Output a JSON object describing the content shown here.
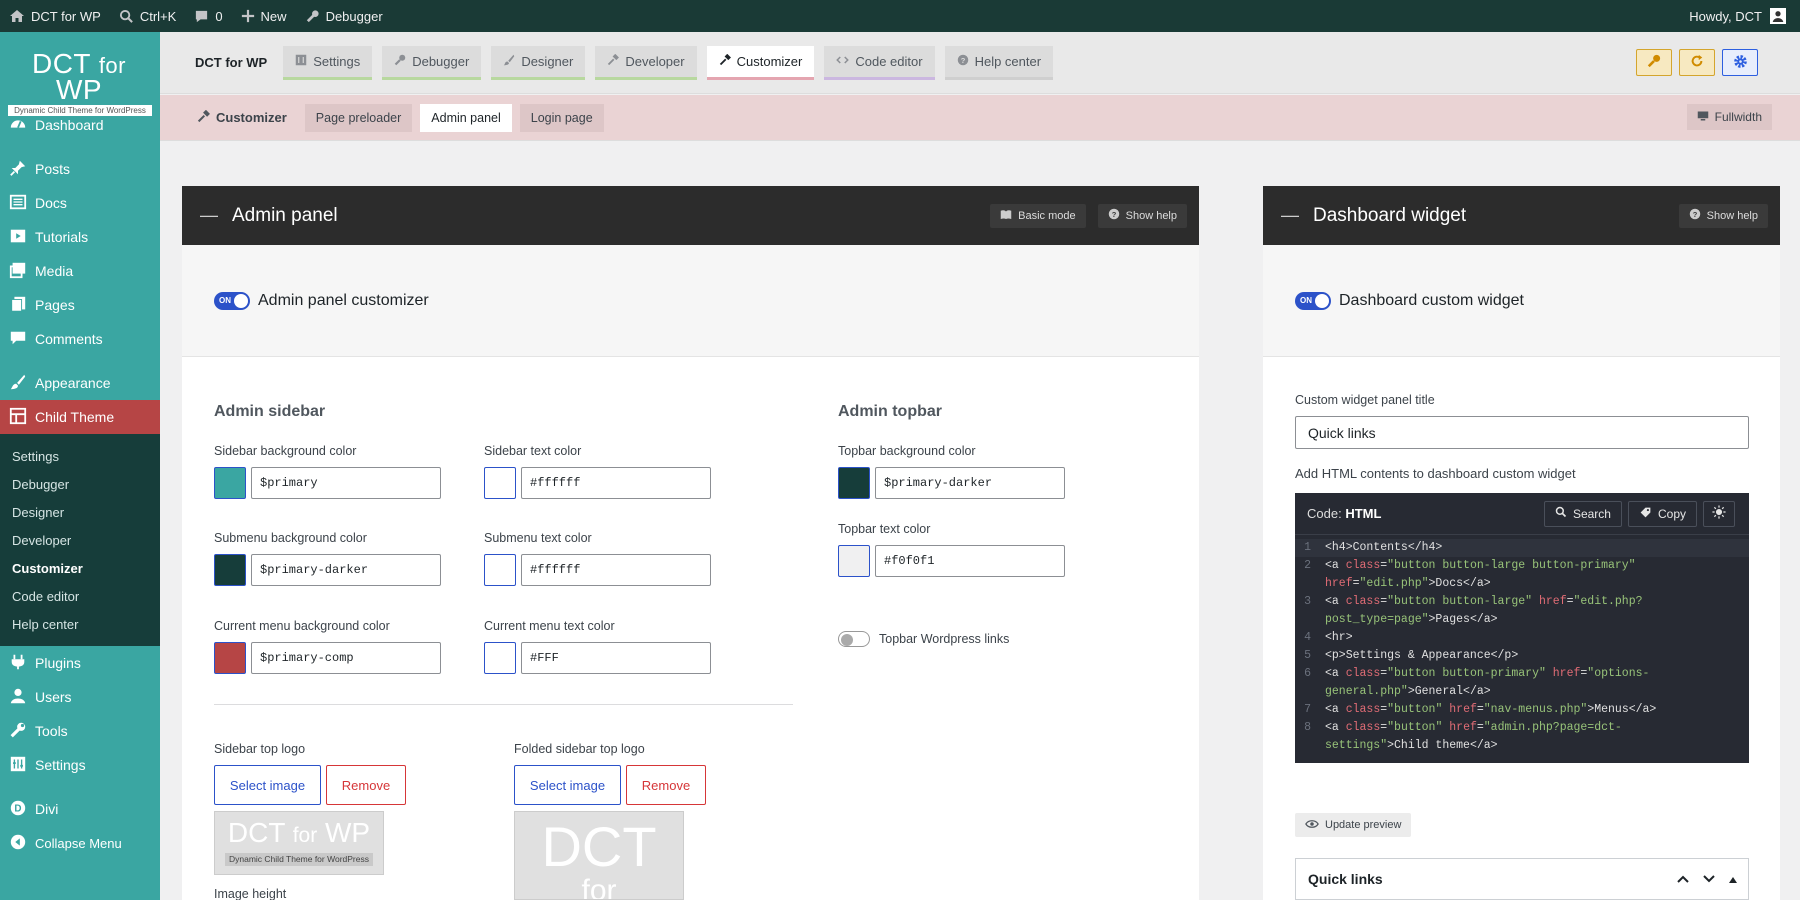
{
  "adminbar": {
    "site": "DCT for WP",
    "search": "Ctrl+K",
    "comments": "0",
    "new": "New",
    "debugger": "Debugger",
    "howdy": "Howdy, DCT"
  },
  "sidebar": {
    "logo_main": "DCT",
    "logo_for": "for",
    "logo_wp": "WP",
    "logo_sub": "Dynamic Child Theme for WordPress",
    "items": [
      {
        "label": "Dashboard",
        "icon": "dashboard-icon"
      },
      {
        "label": "Posts",
        "icon": "pin-icon"
      },
      {
        "label": "Docs",
        "icon": "list-icon"
      },
      {
        "label": "Tutorials",
        "icon": "video-icon"
      },
      {
        "label": "Media",
        "icon": "media-icon"
      },
      {
        "label": "Pages",
        "icon": "page-icon"
      },
      {
        "label": "Comments",
        "icon": "comment-icon"
      },
      {
        "label": "Appearance",
        "icon": "brush-icon"
      },
      {
        "label": "Child Theme",
        "icon": "grid-icon"
      }
    ],
    "submenu": [
      "Settings",
      "Debugger",
      "Designer",
      "Developer",
      "Customizer",
      "Code editor",
      "Help center"
    ],
    "items_bottom": [
      {
        "label": "Plugins",
        "icon": "plug-icon"
      },
      {
        "label": "Users",
        "icon": "user-icon"
      },
      {
        "label": "Tools",
        "icon": "wrench-icon"
      },
      {
        "label": "Settings",
        "icon": "settings-icon"
      },
      {
        "label": "Divi",
        "icon": "divi-icon"
      },
      {
        "label": "Collapse Menu",
        "icon": "collapse-icon"
      }
    ]
  },
  "topnav": {
    "brand": "DCT for WP",
    "tabs": [
      "Settings",
      "Debugger",
      "Designer",
      "Developer",
      "Customizer",
      "Code editor",
      "Help center"
    ]
  },
  "subnav": {
    "label": "Customizer",
    "pills": [
      "Page preloader",
      "Admin panel",
      "Login page"
    ],
    "fullwidth": "Fullwidth"
  },
  "admin_panel": {
    "title": "Admin panel",
    "basic_mode": "Basic mode",
    "show_help": "Show help",
    "toggle_label": "Admin panel customizer",
    "toggle_on": "ON",
    "sidebar_heading": "Admin sidebar",
    "topbar_heading": "Admin topbar",
    "fields": {
      "sidebar_bg": {
        "label": "Sidebar background color",
        "value": "$primary",
        "swatch": "#3aa6a2"
      },
      "sidebar_text": {
        "label": "Sidebar text color",
        "value": "#ffffff",
        "swatch": "#ffffff"
      },
      "submenu_bg": {
        "label": "Submenu background color",
        "value": "$primary-darker",
        "swatch": "#163d3a"
      },
      "submenu_text": {
        "label": "Submenu text color",
        "value": "#ffffff",
        "swatch": "#ffffff"
      },
      "current_bg": {
        "label": "Current menu background color",
        "value": "$primary-comp",
        "swatch": "#b64545"
      },
      "current_text": {
        "label": "Current menu text color",
        "value": "#FFF",
        "swatch": "#ffffff"
      },
      "topbar_bg": {
        "label": "Topbar background color",
        "value": "$primary-darker",
        "swatch": "#163d3a"
      },
      "topbar_text": {
        "label": "Topbar text color",
        "value": "#f0f0f1",
        "swatch": "#f0f0f1"
      }
    },
    "topbar_links": "Topbar Wordpress links",
    "sidebar_logo": "Sidebar top logo",
    "folded_logo": "Folded sidebar top logo",
    "select_image": "Select image",
    "remove": "Remove",
    "image_height": "Image height",
    "thumb_main": "DCT",
    "thumb_for": "for",
    "thumb_wp": "WP",
    "thumb_sub": "Dynamic Child Theme for WordPress"
  },
  "dashboard_widget": {
    "title": "Dashboard widget",
    "show_help": "Show help",
    "toggle_label": "Dashboard custom widget",
    "toggle_on": "ON",
    "panel_title_label": "Custom widget panel title",
    "panel_title_value": "Quick links",
    "html_label": "Add HTML contents to dashboard custom widget",
    "code_prefix": "Code:",
    "code_lang": "HTML",
    "search": "Search",
    "copy": "Copy",
    "update_preview": "Update preview",
    "preview_title": "Quick links"
  },
  "colors": {
    "primary": "#3aa6a2",
    "primary_darker": "#163d3a",
    "primary_comp": "#b64545",
    "accent": "#2c52c9"
  }
}
